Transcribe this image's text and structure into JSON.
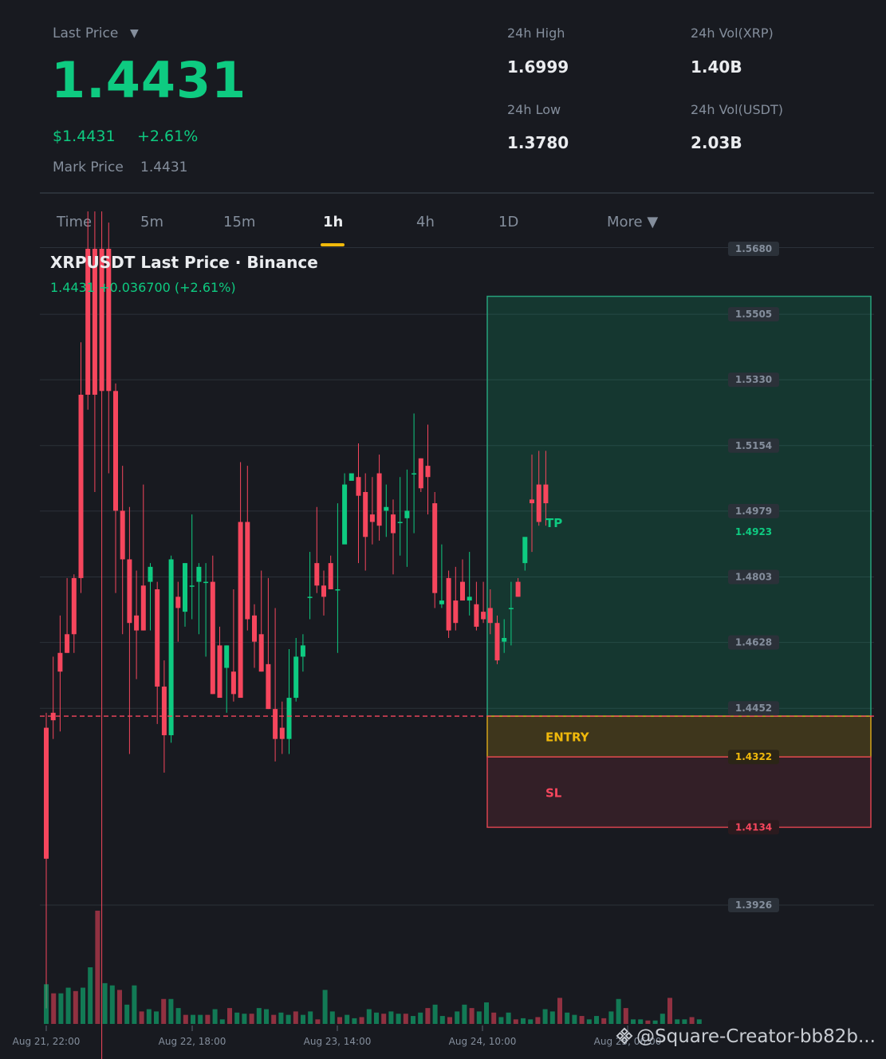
{
  "header": {
    "last_price_label": "Last Price",
    "last_price": "1.4431",
    "usd_price": "$1.4431",
    "change_pct": "+2.61%",
    "mark_price_label": "Mark Price",
    "mark_price": "1.4431",
    "stats": {
      "high_label": "24h High",
      "high": "1.6999",
      "low_label": "24h Low",
      "low": "1.3780",
      "vol_base_label": "24h Vol(XRP)",
      "vol_base": "1.40B",
      "vol_quote_label": "24h Vol(USDT)",
      "vol_quote": "2.03B"
    }
  },
  "tabs": [
    {
      "label": "Time",
      "active": false
    },
    {
      "label": "5m",
      "active": false
    },
    {
      "label": "15m",
      "active": false
    },
    {
      "label": "1h",
      "active": true
    },
    {
      "label": "4h",
      "active": false
    },
    {
      "label": "1D",
      "active": false
    },
    {
      "label": "More ▼",
      "active": false
    }
  ],
  "chart": {
    "title": "XRPUSDT Last Price · Binance",
    "subtitle": "1.4431  +0.036700 (+2.61%)"
  },
  "chart_data": {
    "type": "candlestick",
    "symbol": "XRPUSDT",
    "interval": "1h",
    "y_ticks": [
      1.568,
      1.5505,
      1.533,
      1.5154,
      1.4979,
      1.4803,
      1.4628,
      1.4452,
      1.3926
    ],
    "ylim": [
      1.3926,
      1.568
    ],
    "x_tick_labels": [
      "Aug 21, 22:00",
      "Aug 22, 18:00",
      "Aug 23, 14:00",
      "Aug 24, 10:00",
      "Aug 25, 06:00"
    ],
    "last_price": 1.4431,
    "levels": {
      "tp": {
        "label": "TP",
        "price": 1.4923,
        "top": 1.5553
      },
      "entry": {
        "label": "ENTRY",
        "price": 1.4322,
        "top": 1.4431
      },
      "sl": {
        "label": "SL",
        "price": 1.4134
      }
    },
    "level_labels": {
      "tp": "1.4923",
      "entry": "1.4322",
      "sl": "1.4134"
    },
    "candles": [
      [
        1.44,
        1.444,
        1.405,
        1.365
      ],
      [
        1.444,
        1.459,
        1.442,
        1.437
      ],
      [
        1.46,
        1.47,
        1.455,
        1.439
      ],
      [
        1.465,
        1.48,
        1.46,
        1.46
      ],
      [
        1.48,
        1.481,
        1.465,
        1.46
      ],
      [
        1.529,
        1.543,
        1.48,
        1.476
      ],
      [
        1.568,
        1.578,
        1.529,
        1.525
      ],
      [
        1.568,
        1.578,
        1.529,
        1.503
      ],
      [
        1.568,
        1.578,
        1.53,
        1.33
      ],
      [
        1.568,
        1.575,
        1.53,
        1.508
      ],
      [
        1.53,
        1.532,
        1.498,
        1.476
      ],
      [
        1.498,
        1.51,
        1.485,
        1.465
      ],
      [
        1.485,
        1.499,
        1.468,
        1.433
      ],
      [
        1.47,
        1.482,
        1.466,
        1.453
      ],
      [
        1.478,
        1.505,
        1.466,
        1.466
      ],
      [
        1.479,
        1.484,
        1.483,
        1.466
      ],
      [
        1.477,
        1.479,
        1.451,
        1.441
      ],
      [
        1.451,
        1.458,
        1.438,
        1.428
      ],
      [
        1.438,
        1.486,
        1.485,
        1.436
      ],
      [
        1.475,
        1.479,
        1.472,
        1.463
      ],
      [
        1.471,
        1.484,
        1.484,
        1.467
      ],
      [
        1.478,
        1.497,
        1.478,
        1.469
      ],
      [
        1.479,
        1.484,
        1.483,
        1.465
      ],
      [
        1.479,
        1.484,
        1.479,
        1.459
      ],
      [
        1.479,
        1.486,
        1.449,
        1.449
      ],
      [
        1.462,
        1.467,
        1.448,
        1.448
      ],
      [
        1.456,
        1.462,
        1.462,
        1.444
      ],
      [
        1.455,
        1.477,
        1.449,
        1.447
      ],
      [
        1.495,
        1.511,
        1.448,
        1.448
      ],
      [
        1.495,
        1.51,
        1.469,
        1.466
      ],
      [
        1.47,
        1.473,
        1.463,
        1.456
      ],
      [
        1.465,
        1.482,
        1.455,
        1.455
      ],
      [
        1.457,
        1.48,
        1.445,
        1.445
      ],
      [
        1.445,
        1.472,
        1.437,
        1.431
      ],
      [
        1.44,
        1.447,
        1.437,
        1.433
      ],
      [
        1.437,
        1.461,
        1.448,
        1.433
      ],
      [
        1.448,
        1.464,
        1.459,
        1.447
      ],
      [
        1.459,
        1.465,
        1.462,
        1.455
      ],
      [
        1.475,
        1.487,
        1.475,
        1.469
      ],
      [
        1.484,
        1.499,
        1.478,
        1.476
      ],
      [
        1.478,
        1.482,
        1.475,
        1.47
      ],
      [
        1.484,
        1.486,
        1.477,
        1.477
      ],
      [
        1.477,
        1.5,
        1.477,
        1.46
      ],
      [
        1.489,
        1.508,
        1.505,
        1.492
      ],
      [
        1.506,
        1.507,
        1.508,
        1.507
      ],
      [
        1.507,
        1.516,
        1.502,
        1.484
      ],
      [
        1.503,
        1.508,
        1.491,
        1.482
      ],
      [
        1.497,
        1.507,
        1.495,
        1.489
      ],
      [
        1.508,
        1.513,
        1.494,
        1.49
      ],
      [
        1.498,
        1.505,
        1.499,
        1.491
      ],
      [
        1.497,
        1.501,
        1.492,
        1.481
      ],
      [
        1.495,
        1.507,
        1.495,
        1.486
      ],
      [
        1.496,
        1.509,
        1.498,
        1.483
      ],
      [
        1.508,
        1.524,
        1.508,
        1.492
      ],
      [
        1.512,
        1.512,
        1.504,
        1.503
      ],
      [
        1.51,
        1.521,
        1.507,
        1.497
      ],
      [
        1.5,
        1.503,
        1.476,
        1.472
      ],
      [
        1.473,
        1.489,
        1.474,
        1.472
      ],
      [
        1.48,
        1.482,
        1.466,
        1.464
      ],
      [
        1.474,
        1.483,
        1.468,
        1.466
      ],
      [
        1.479,
        1.485,
        1.474,
        1.474
      ],
      [
        1.474,
        1.487,
        1.475,
        1.47
      ],
      [
        1.473,
        1.479,
        1.467,
        1.466
      ],
      [
        1.471,
        1.479,
        1.469,
        1.468
      ],
      [
        1.472,
        1.477,
        1.468,
        1.465
      ],
      [
        1.468,
        1.47,
        1.458,
        1.457
      ],
      [
        1.463,
        1.469,
        1.464,
        1.46
      ],
      [
        1.472,
        1.479,
        1.472,
        1.462
      ],
      [
        1.479,
        1.48,
        1.475,
        1.475
      ],
      [
        1.484,
        1.49,
        1.491,
        1.482
      ],
      [
        1.501,
        1.513,
        1.5,
        1.487
      ],
      [
        1.505,
        1.514,
        1.495,
        1.494
      ],
      [
        1.505,
        1.514,
        1.5,
        1.494
      ]
    ],
    "volume": [
      0.35,
      0.27,
      0.27,
      0.32,
      0.29,
      0.32,
      0.5,
      1.0,
      0.36,
      0.34,
      0.3,
      0.17,
      0.34,
      0.11,
      0.13,
      0.11,
      0.22,
      0.22,
      0.14,
      0.08,
      0.08,
      0.08,
      0.08,
      0.13,
      0.04,
      0.14,
      0.1,
      0.09,
      0.09,
      0.14,
      0.13,
      0.08,
      0.1,
      0.08,
      0.11,
      0.08,
      0.11,
      0.04,
      0.3,
      0.11,
      0.06,
      0.08,
      0.05,
      0.06,
      0.13,
      0.1,
      0.09,
      0.11,
      0.09,
      0.09,
      0.07,
      0.1,
      0.14,
      0.17,
      0.07,
      0.06,
      0.11,
      0.17,
      0.14,
      0.11,
      0.19,
      0.1,
      0.06,
      0.1,
      0.04,
      0.05,
      0.04,
      0.06,
      0.13,
      0.11,
      0.23,
      0.1,
      0.08,
      0.07,
      0.04,
      0.07,
      0.05,
      0.11,
      0.22,
      0.14,
      0.04,
      0.04,
      0.03,
      0.03,
      0.09,
      0.23,
      0.04,
      0.04,
      0.06,
      0.04
    ]
  },
  "watermark": "@Square-Creator-bb82b...",
  "colors": {
    "up": "#0ecb81",
    "down": "#f6465d",
    "accent": "#f0b90b",
    "background": "#181a20",
    "muted": "#848e9c"
  }
}
